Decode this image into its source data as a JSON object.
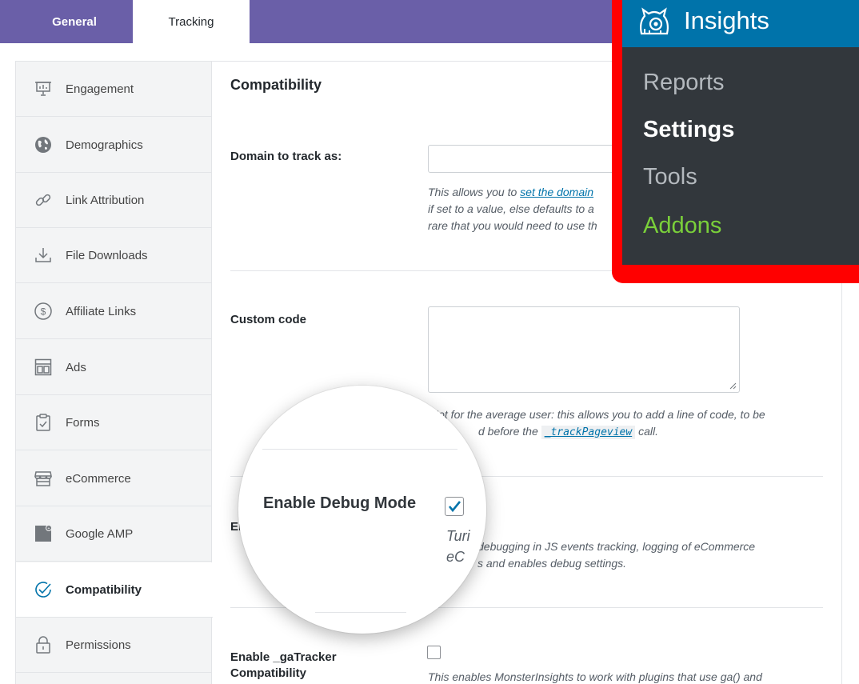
{
  "tabs": {
    "general": "General",
    "tracking": "Tracking"
  },
  "sidebar": {
    "items": [
      {
        "label": "Engagement",
        "icon": "presentation-icon"
      },
      {
        "label": "Demographics",
        "icon": "globe-icon"
      },
      {
        "label": "Link Attribution",
        "icon": "link-icon"
      },
      {
        "label": "File Downloads",
        "icon": "download-icon"
      },
      {
        "label": "Affiliate Links",
        "icon": "dollar-icon"
      },
      {
        "label": "Ads",
        "icon": "ads-layout-icon"
      },
      {
        "label": "Forms",
        "icon": "clipboard-icon"
      },
      {
        "label": "eCommerce",
        "icon": "store-icon"
      },
      {
        "label": "Google AMP",
        "icon": "amp-icon"
      },
      {
        "label": "Compatibility",
        "icon": "check-circle-icon"
      },
      {
        "label": "Permissions",
        "icon": "lock-icon"
      }
    ],
    "active": "Compatibility"
  },
  "content": {
    "section_title": "Compatibility",
    "domain": {
      "label": "Domain to track as:",
      "value": "",
      "help_prefix": "This allows you to ",
      "help_link": "set the domain",
      "help_line2": "if set to a value, else defaults to a",
      "help_line3": "rare that you would need to use th"
    },
    "custom_code": {
      "label": "Custom code",
      "value": "",
      "help_line1": "Not for the average user: this allows you to add a line of code, to be",
      "help_line2_prefix": "d before the ",
      "help_code": "_trackPageview",
      "help_line2_suffix": " call."
    },
    "debug": {
      "label_behind": "En",
      "help_line1": "debugging in JS events tracking, logging of eCommerce",
      "help_line2": "s and enables debug settings."
    },
    "gatracker": {
      "label_line1": "Enable _gaTracker",
      "label_line2": "Compatibility",
      "checked": false,
      "help": "This enables MonsterInsights to work with plugins that use ga() and"
    }
  },
  "magnifier": {
    "label": "Enable Debug Mode",
    "checked": true,
    "help_line1": "Turi",
    "help_line2": "eC"
  },
  "insights_menu": {
    "title": "Insights",
    "items": {
      "reports": "Reports",
      "settings": "Settings",
      "tools": "Tools",
      "addons": "Addons"
    },
    "colors": {
      "header": "#0073aa",
      "menu_bg": "#32373c",
      "highlight_border": "#ff0000",
      "addons": "#7ad03a"
    }
  },
  "colors": {
    "topbar": "#6a5fa8",
    "link": "#0073aa",
    "check": "#0073aa"
  }
}
